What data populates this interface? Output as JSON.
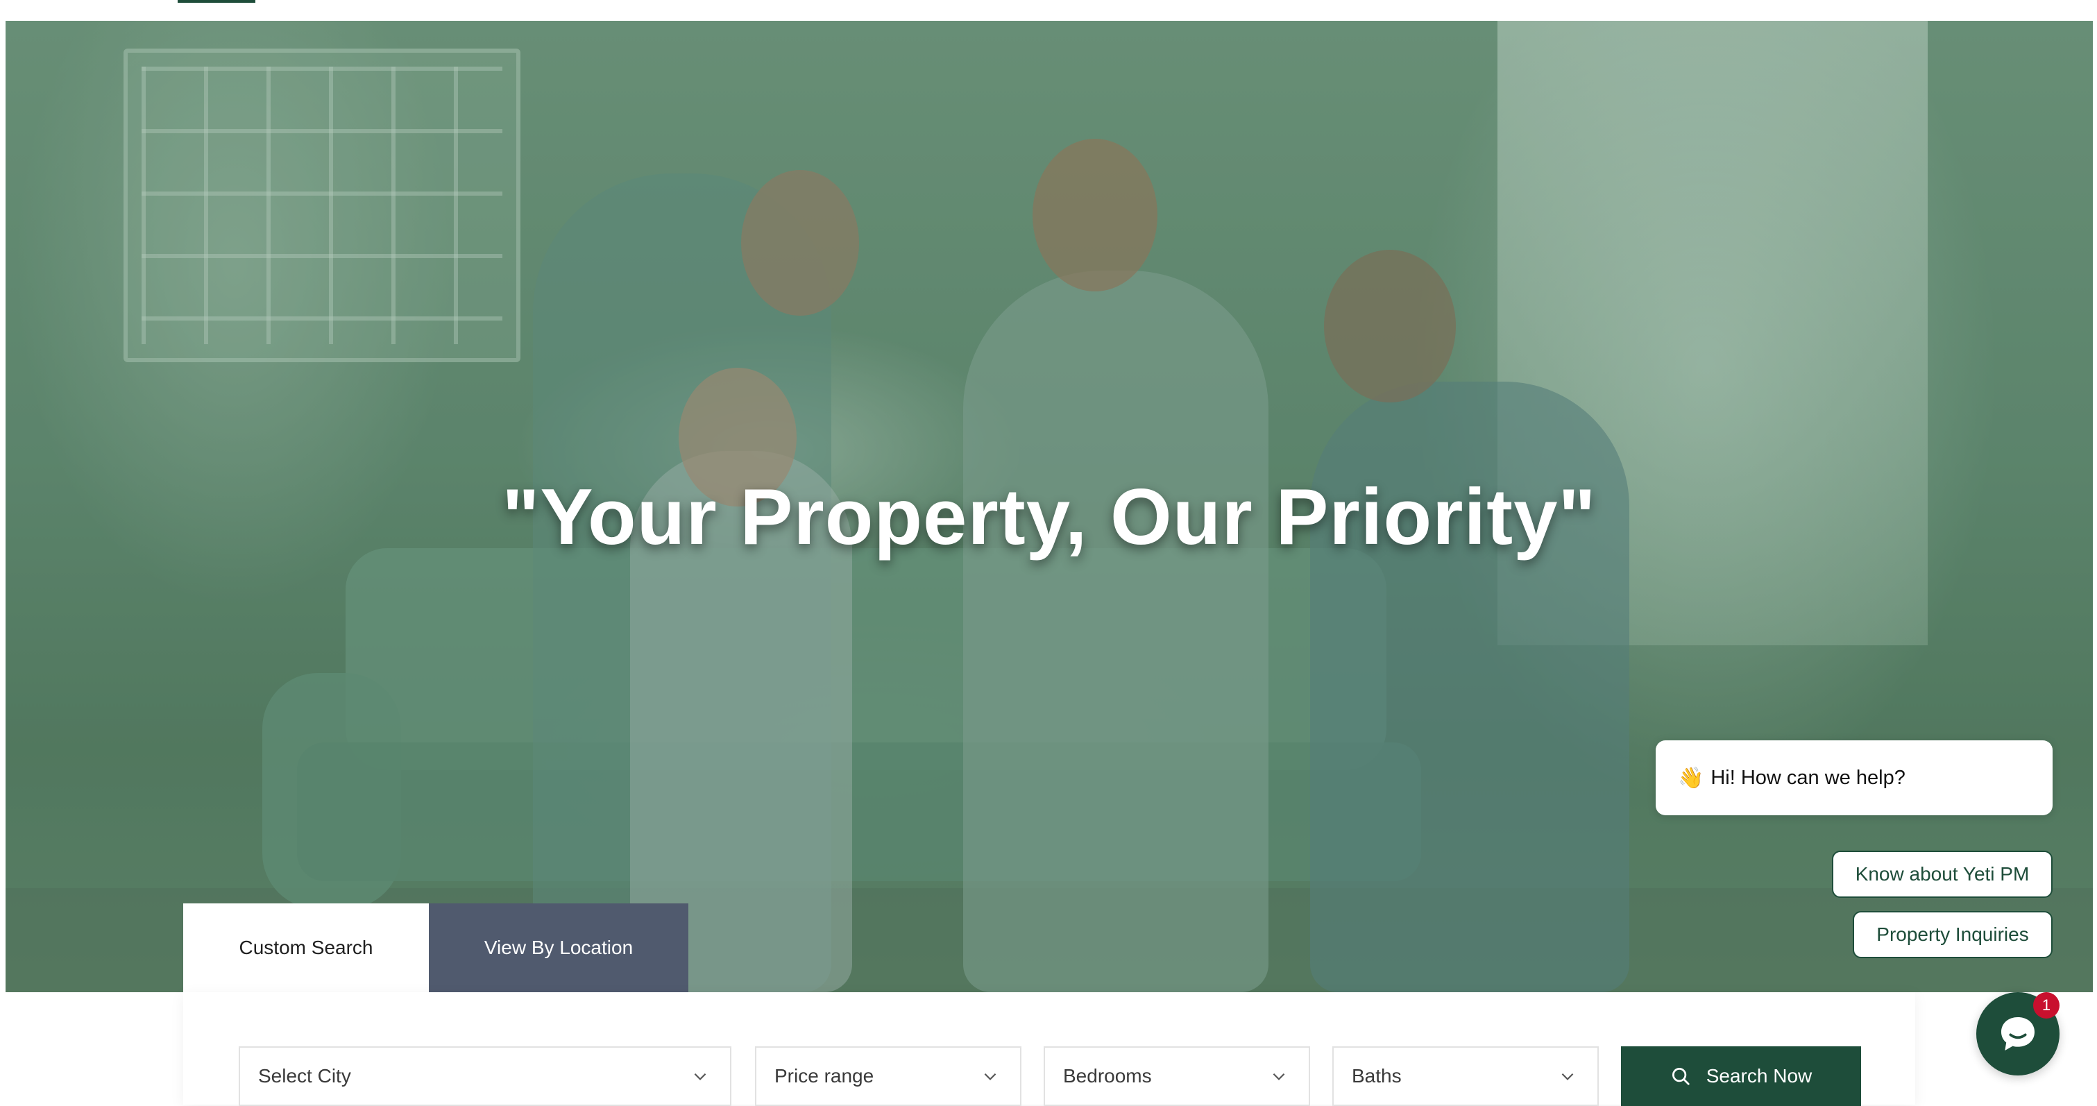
{
  "colors": {
    "brand_green": "#1e4d3a",
    "tab_inactive_bg": "#505a6e",
    "badge_red": "#c8102e"
  },
  "hero": {
    "headline": "\"Your Property, Our Priority\""
  },
  "search_tabs": [
    {
      "label": "Custom Search",
      "active": true
    },
    {
      "label": "View By Location",
      "active": false
    }
  ],
  "search": {
    "city_label": "Select City",
    "price_label": "Price range",
    "bedrooms_label": "Bedrooms",
    "baths_label": "Baths",
    "button_label": "Search Now",
    "button_icon": "search-icon"
  },
  "chat": {
    "greeting_emoji": "👋",
    "greeting": "Hi! How can we help?",
    "options": [
      {
        "label": "Know about Yeti PM"
      },
      {
        "label": "Property Inquiries"
      }
    ],
    "launcher_icon": "chat-bubble-icon",
    "unread_count": "1"
  }
}
